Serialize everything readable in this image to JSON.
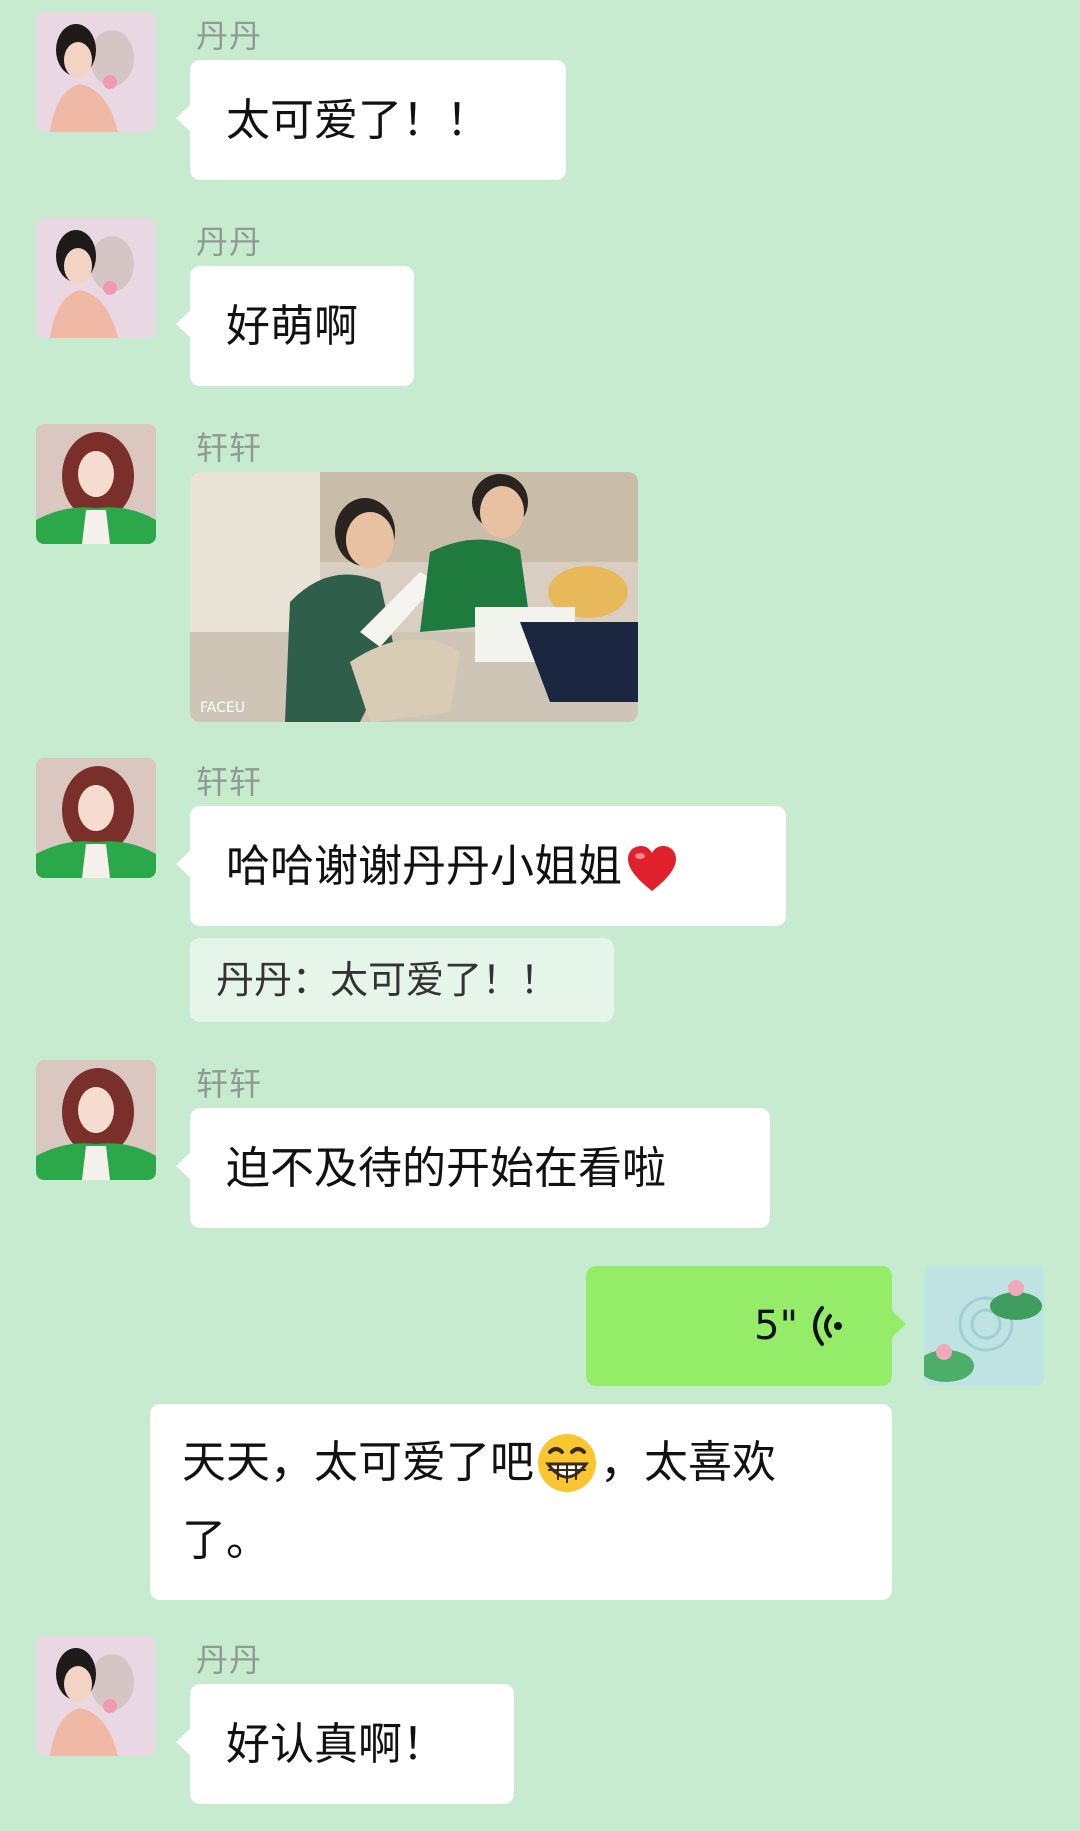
{
  "contacts": {
    "dandan": {
      "name": "丹丹"
    },
    "xuanxuan": {
      "name": "轩轩"
    }
  },
  "messages": {
    "m1": {
      "sender": "丹丹",
      "text": "太可爱了！！"
    },
    "m2": {
      "sender": "丹丹",
      "text": "好萌啊"
    },
    "m3": {
      "sender": "轩轩",
      "image_caption": "FACEU",
      "image_desc": "two-boys-reading-photo"
    },
    "m4": {
      "sender": "轩轩",
      "text": "哈哈谢谢丹丹小姐姐",
      "emoji": "red-heart-icon"
    },
    "m4_quote": {
      "text": "丹丹：太可爱了！！"
    },
    "m5": {
      "sender": "轩轩",
      "text": "迫不及待的开始在看啦"
    },
    "m6": {
      "voice_duration": "5\"",
      "icon": "voice-wave-icon"
    },
    "m7": {
      "text_part1": "天天，太可爱了吧",
      "emoji": "grinning-face-icon",
      "text_part2": "，太喜欢",
      "text_line2": "了。"
    },
    "m8": {
      "sender": "丹丹",
      "text": "好认真啊！"
    }
  },
  "colors": {
    "background": "#c6ebce",
    "bubble_incoming": "#ffffff",
    "bubble_outgoing": "#95ec69",
    "quote_bg": "#e6f5ea",
    "name_color": "#8f9a93"
  }
}
